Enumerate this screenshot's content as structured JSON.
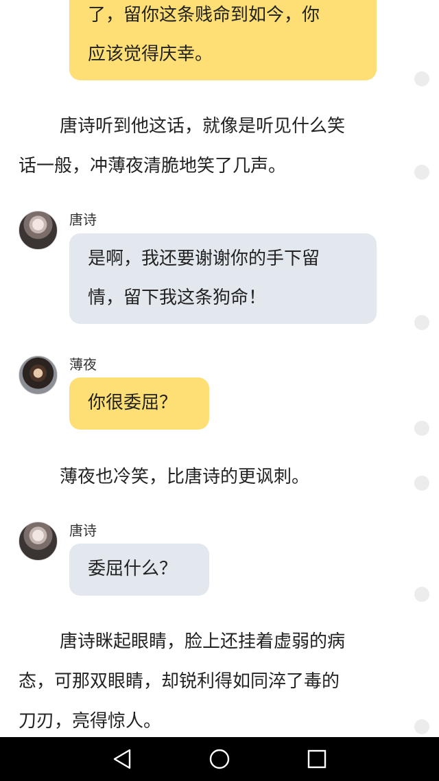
{
  "messages": {
    "top_bubble": {
      "line1": "了，留你这条贱命到如今，你",
      "line2": "应该觉得庆幸。"
    },
    "narration1": {
      "line1": "唐诗听到他这话，就像是听见什么笑",
      "line2": "话一般，冲薄夜清脆地笑了几声。"
    },
    "msg1": {
      "name": "唐诗",
      "line1": "是啊，我还要谢谢你的手下留",
      "line2": "情，留下我这条狗命！"
    },
    "msg2": {
      "name": "薄夜",
      "line1": "你很委屈？"
    },
    "narration2": {
      "line1": "薄夜也冷笑，比唐诗的更讽刺。"
    },
    "msg3": {
      "name": "唐诗",
      "line1": "委屈什么？"
    },
    "narration3": {
      "line1": "唐诗眯起眼睛，脸上还挂着虚弱的病",
      "line2": "态，可那双眼睛，却锐利得如同淬了毒的",
      "line3": "刀刃，亮得惊人。"
    }
  },
  "colors": {
    "accent_bubble": "#fddf75",
    "gray_bubble": "#e3e7ee"
  },
  "navbar": {
    "icons": [
      "back-triangle-icon",
      "home-circle-icon",
      "recent-square-icon"
    ]
  }
}
